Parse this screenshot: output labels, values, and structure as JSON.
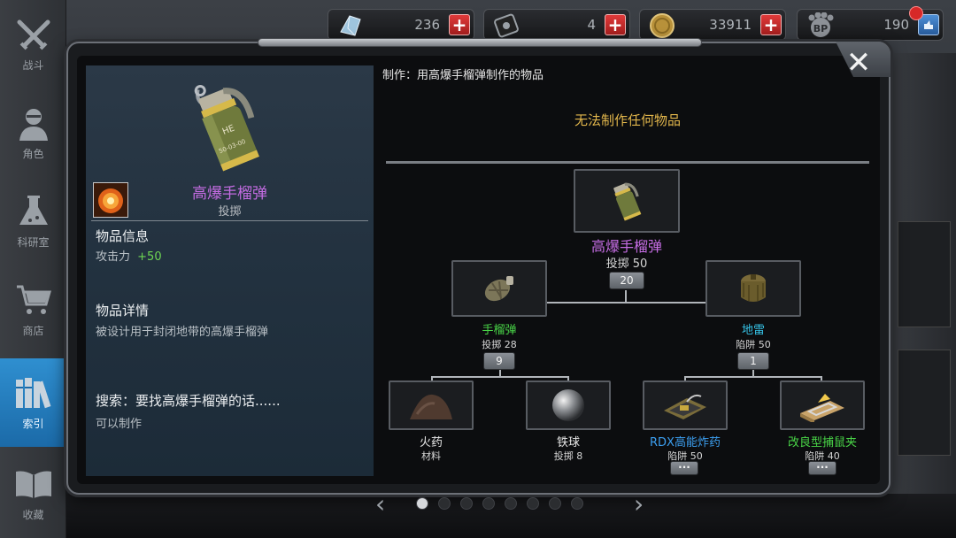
{
  "nav": {
    "items": [
      {
        "label": "战斗",
        "icon": "crossed-swords-icon"
      },
      {
        "label": "角色",
        "icon": "character-icon"
      },
      {
        "label": "科研室",
        "icon": "flask-icon"
      },
      {
        "label": "商店",
        "icon": "cart-icon"
      },
      {
        "label": "索引",
        "icon": "books-icon",
        "active": true
      },
      {
        "label": "收藏",
        "icon": "open-book-icon"
      }
    ]
  },
  "resources": [
    {
      "name": "crystal",
      "value": "236",
      "icon": "crystal-icon"
    },
    {
      "name": "card",
      "value": "4",
      "icon": "card-icon"
    },
    {
      "name": "gold",
      "value": "33911",
      "icon": "coin-icon"
    },
    {
      "name": "bp",
      "value": "190",
      "icon": "bp-paw-icon",
      "icon_text": "BP"
    }
  ],
  "item": {
    "name": "高爆手榴弹",
    "type": "投掷",
    "info_title": "物品信息",
    "attack_label": "攻击力",
    "attack_value": "+50",
    "detail_title": "物品详情",
    "detail_text": "被设计用于封闭地带的高爆手榴弹",
    "search_title": "搜索：要找高爆手榴弹的话......",
    "search_text": "可以制作",
    "grenade_marking": "HE",
    "grenade_code": "50-03-00"
  },
  "craft": {
    "header": "制作：用高爆手榴弹制作的物品",
    "empty_text": "无法制作任何物品"
  },
  "tree": {
    "root": {
      "name": "高爆手榴弹",
      "sub": "投掷 50",
      "count": "20"
    },
    "left": {
      "name": "手榴弹",
      "sub": "投掷 28",
      "count": "9"
    },
    "right": {
      "name": "地雷",
      "sub": "陷阱 50",
      "count": "1"
    },
    "leaves": [
      {
        "name": "火药",
        "sub": "材料"
      },
      {
        "name": "铁球",
        "sub": "投掷 8"
      },
      {
        "name": "RDX高能炸药",
        "sub": "陷阱 50",
        "more": "···"
      },
      {
        "name": "改良型捕鼠夹",
        "sub": "陷阱 40",
        "more": "···"
      }
    ]
  },
  "pager": {
    "total": 8,
    "current": 1
  },
  "colors": {
    "accent": "#2f8fd0",
    "epic": "#c46ce2",
    "rare": "#3c9ff0",
    "uncommon": "#49d447",
    "warning": "#e3b74c"
  }
}
